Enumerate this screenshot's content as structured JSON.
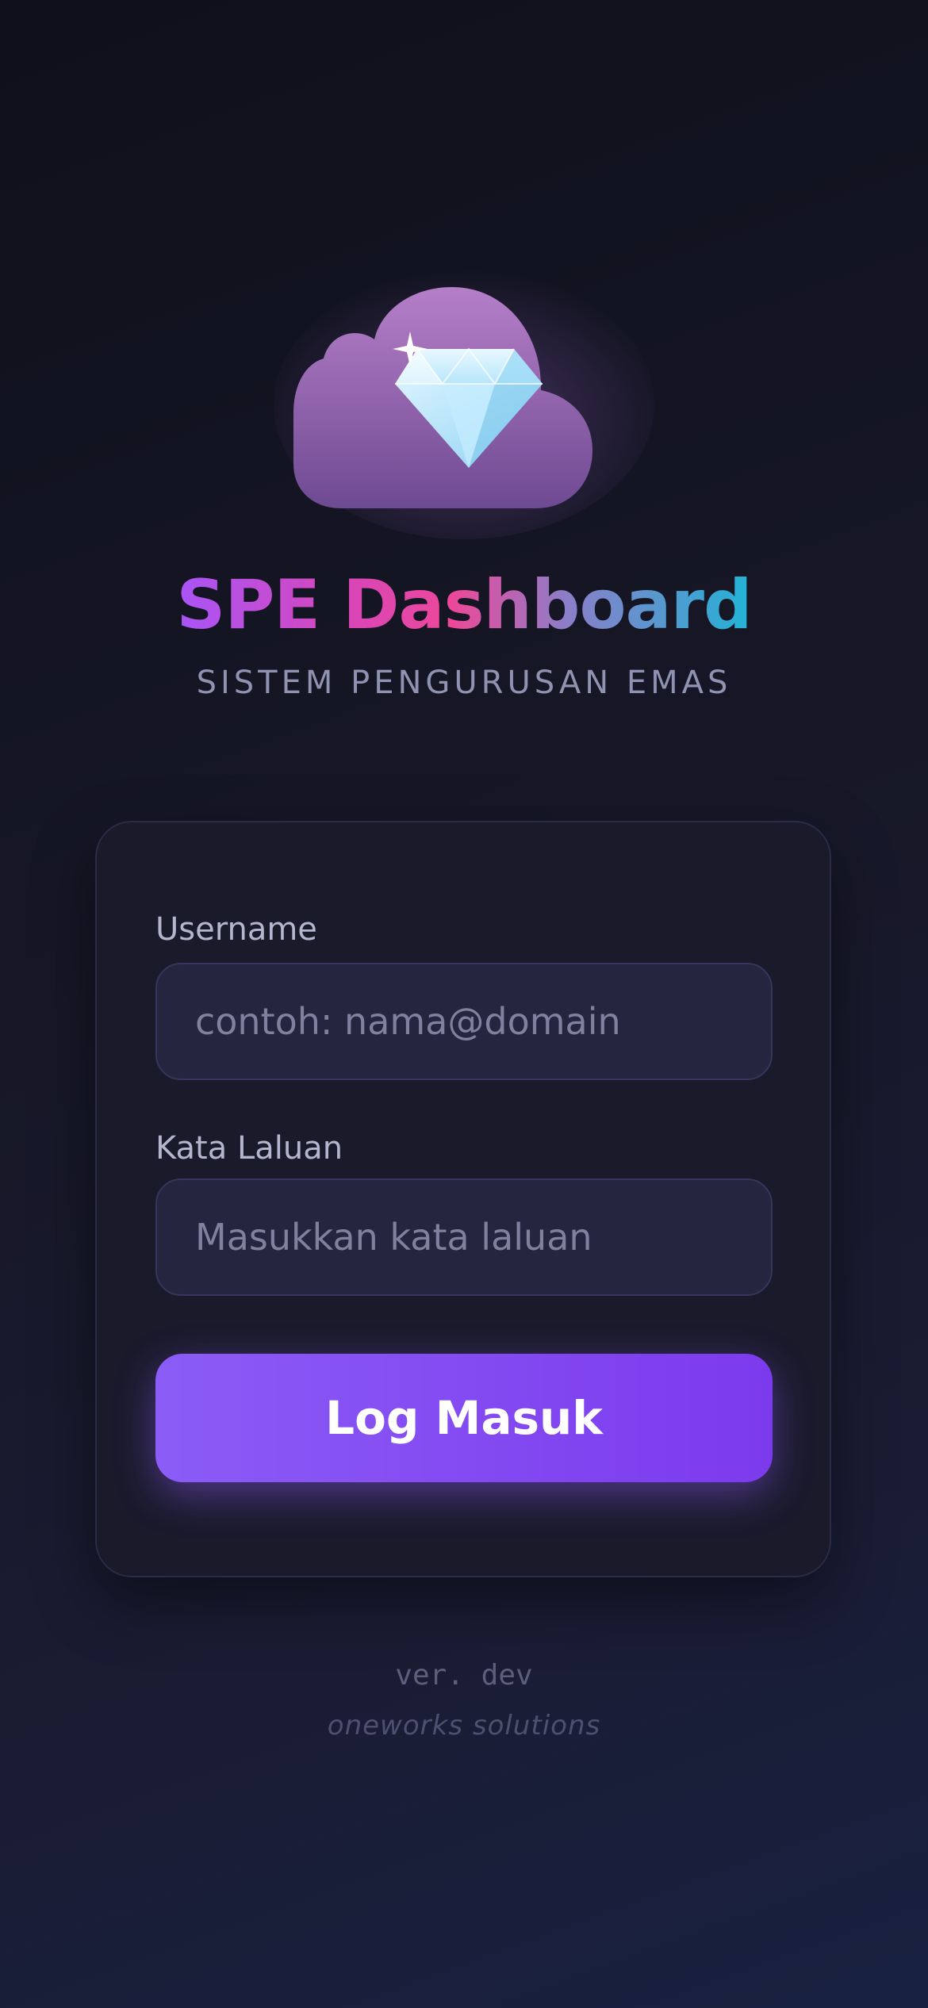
{
  "app": {
    "title": "SPE Dashboard",
    "subtitle": "SISTEM PENGURUSAN EMAS",
    "logo_icon": "cloud-diamond-icon"
  },
  "login_form": {
    "username_label": "Username",
    "username_value": "",
    "username_placeholder": "contoh: nama@domain",
    "password_label": "Kata Laluan",
    "password_value": "",
    "password_placeholder": "Masukkan kata laluan",
    "submit_label": "Log Masuk"
  },
  "footer": {
    "version": "ver. dev",
    "company": "oneworks solutions"
  },
  "colors": {
    "accent": "#8b5cf6",
    "accent_dark": "#7c3aed",
    "background": "#151625",
    "card": "#1a1a2b",
    "input": "#26253f",
    "cloud": "#9b5fb0"
  }
}
